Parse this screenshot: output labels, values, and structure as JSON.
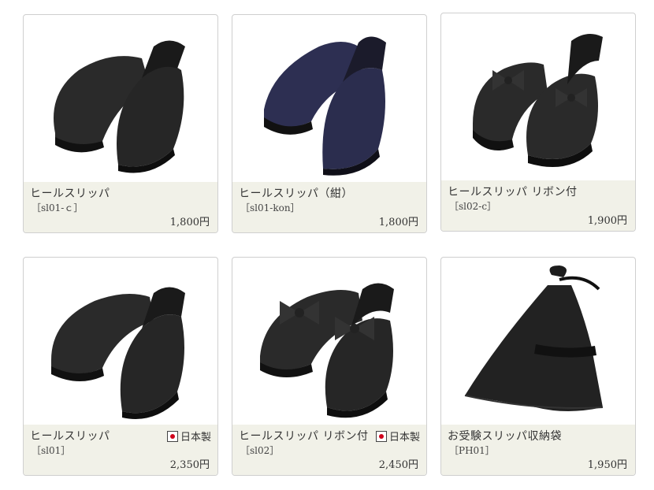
{
  "products": [
    {
      "name": "ヒールスリッパ",
      "code": "［sl01-ｃ］",
      "price": "1,800円",
      "made_in_japan": false,
      "color": "#252525",
      "bow": false
    },
    {
      "name": "ヒールスリッパ（紺）",
      "code": "［sl01-kon］",
      "price": "1,800円",
      "made_in_japan": false,
      "color": "#2a2c4a",
      "bow": false
    },
    {
      "name": "ヒールスリッパ リボン付",
      "code": "［sl02-c］",
      "price": "1,900円",
      "made_in_japan": false,
      "color": "#262626",
      "bow": true
    },
    {
      "name": "ヒールスリッパ",
      "code": "［sl01］",
      "price": "2,350円",
      "made_in_japan": true,
      "badge_label": "日本製",
      "color": "#252525",
      "bow": false
    },
    {
      "name": "ヒールスリッパ リボン付",
      "code": "［sl02］",
      "price": "2,450円",
      "made_in_japan": true,
      "badge_label": "日本製",
      "color": "#232323",
      "bow": true
    },
    {
      "name": "お受験スリッパ収納袋",
      "code": "［PH01］",
      "price": "1,950円",
      "made_in_japan": false,
      "color": "#1e1e1e",
      "bow": false,
      "bag": true
    }
  ]
}
